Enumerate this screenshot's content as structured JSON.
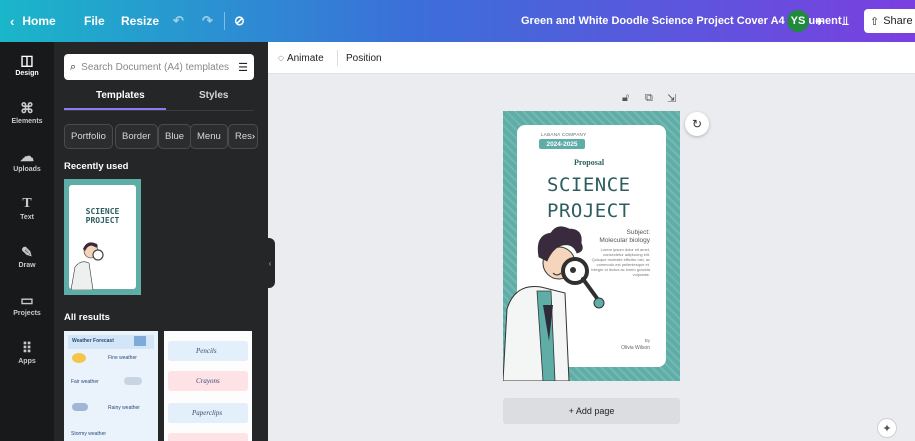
{
  "topbar": {
    "home": "Home",
    "file": "File",
    "resize": "Resize",
    "doc_title": "Green and White Doodle Science Project Cover A4 Document",
    "avatar": "YS",
    "share": "Share"
  },
  "rail": {
    "items": [
      {
        "label": "Design",
        "icon": "layout-icon"
      },
      {
        "label": "Elements",
        "icon": "shapes-icon"
      },
      {
        "label": "Uploads",
        "icon": "cloud-upload-icon"
      },
      {
        "label": "Text",
        "icon": "text-icon"
      },
      {
        "label": "Draw",
        "icon": "pen-icon"
      },
      {
        "label": "Projects",
        "icon": "folder-icon"
      },
      {
        "label": "Apps",
        "icon": "grid-icon"
      }
    ]
  },
  "panel": {
    "search_placeholder": "Search Document (A4) templates",
    "tabs": [
      "Templates",
      "Styles"
    ],
    "chips": [
      "Portfolio",
      "Border",
      "Blue",
      "Menu",
      "Res"
    ],
    "recently_used": "Recently used",
    "all_results": "All results",
    "recent_thumb": {
      "line1": "SCIENCE",
      "line2": "PROJECT"
    },
    "weather_thumb": {
      "title": "Weather Forecast",
      "items": [
        "Fine weather",
        "Fair weather",
        "Rainy weather",
        "Stormy weather"
      ]
    },
    "labels_thumb": {
      "items": [
        "Pencils",
        "Crayons",
        "Paperclips"
      ]
    }
  },
  "toolbar": {
    "animate": "Animate",
    "position": "Position"
  },
  "document": {
    "company": "LABANA COMPANY",
    "year": "2024-2025",
    "proposal": "Proposal",
    "title1": "SCIENCE",
    "title2": "PROJECT",
    "subject_label": "Subject:",
    "subject": "Molecular biology",
    "body": "Lorem ipsum dolor sit amet, consectetur adipiscing elit. Quisque molestie efficitur nisi, ac commodo est pellentesque et. Integer id lectus ac lorem gravida vulputate.",
    "by": "By",
    "author": "Olivia Wilson"
  },
  "canvas": {
    "add_page": "+ Add page"
  },
  "colors": {
    "teal": "#5fada7",
    "dark_teal": "#2e5d5f",
    "accent_purple": "#8b7cf6"
  }
}
